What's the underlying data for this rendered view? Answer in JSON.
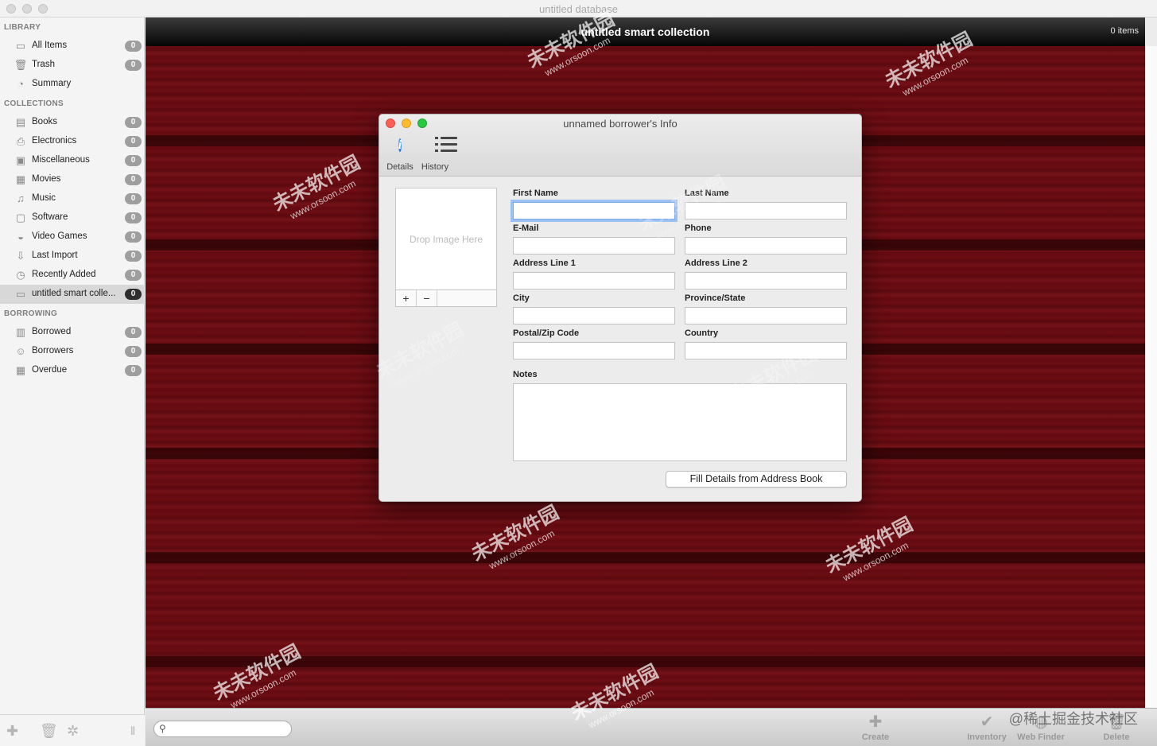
{
  "window": {
    "title": "untitled database"
  },
  "sidebar": {
    "sections": [
      {
        "label": "LIBRARY",
        "items": [
          {
            "label": "All Items",
            "count": "0",
            "icon": "tray-icon"
          },
          {
            "label": "Trash",
            "count": "0",
            "icon": "trash-icon"
          },
          {
            "label": "Summary",
            "icon": "pie-chart-icon"
          }
        ]
      },
      {
        "label": "COLLECTIONS",
        "items": [
          {
            "label": "Books",
            "count": "0",
            "icon": "book-icon"
          },
          {
            "label": "Electronics",
            "count": "0",
            "icon": "printer-icon"
          },
          {
            "label": "Miscellaneous",
            "count": "0",
            "icon": "box-icon"
          },
          {
            "label": "Movies",
            "count": "0",
            "icon": "film-icon"
          },
          {
            "label": "Music",
            "count": "0",
            "icon": "music-note-icon"
          },
          {
            "label": "Software",
            "count": "0",
            "icon": "monitor-icon"
          },
          {
            "label": "Video Games",
            "count": "0",
            "icon": "gamepad-icon"
          },
          {
            "label": "Last Import",
            "count": "0",
            "icon": "import-icon"
          },
          {
            "label": "Recently Added",
            "count": "0",
            "icon": "clock-icon"
          },
          {
            "label": "untitled smart colle...",
            "count": "0",
            "icon": "smart-folder-icon",
            "selected": true
          }
        ]
      },
      {
        "label": "BORROWING",
        "items": [
          {
            "label": "Borrowed",
            "count": "0",
            "icon": "borrowed-icon"
          },
          {
            "label": "Borrowers",
            "count": "0",
            "icon": "people-icon"
          },
          {
            "label": "Overdue",
            "count": "0",
            "icon": "calendar-icon"
          }
        ]
      }
    ]
  },
  "main": {
    "title": "untitled smart collection",
    "item_count": "0 items",
    "search": {
      "value": "",
      "placeholder": ""
    },
    "toolbar": {
      "create": "Create",
      "inventory": "Inventory",
      "web_finder": "Web Finder",
      "delete": "Delete"
    }
  },
  "dialog": {
    "title": "unnamed borrower's Info",
    "tabs": {
      "details": "Details",
      "history": "History"
    },
    "image_well": {
      "placeholder": "Drop Image Here",
      "add": "+",
      "remove": "−"
    },
    "labels": {
      "first_name": "First Name",
      "last_name": "Last Name",
      "email": "E-Mail",
      "phone": "Phone",
      "address1": "Address Line 1",
      "address2": "Address Line 2",
      "city": "City",
      "province": "Province/State",
      "postal": "Postal/Zip Code",
      "country": "Country",
      "notes": "Notes"
    },
    "values": {
      "first_name": "",
      "last_name": "",
      "email": "",
      "phone": "",
      "address1": "",
      "address2": "",
      "city": "",
      "province": "",
      "postal": "",
      "country": "",
      "notes": ""
    },
    "fill_button": "Fill Details from Address Book"
  },
  "watermark": {
    "brand": "未未软件园",
    "url": "www.orsoon.com",
    "corner": "@稀土掘金技术社区"
  },
  "colors": {
    "wood": "#650d12",
    "accent": "#1a6fe0",
    "close": "#fc5f57",
    "minimize": "#fdbc2e",
    "maximize": "#28c840"
  }
}
